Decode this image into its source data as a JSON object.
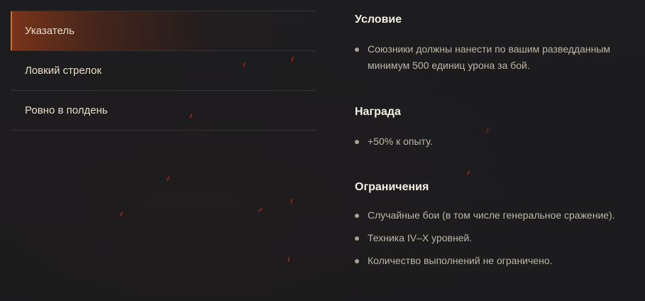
{
  "menu": {
    "items": [
      {
        "label": "Указатель",
        "active": true
      },
      {
        "label": "Ловкий стрелок",
        "active": false
      },
      {
        "label": "Ровно в полдень",
        "active": false
      }
    ]
  },
  "sections": {
    "condition": {
      "title": "Условие",
      "items": [
        "Союзники должны нанести по вашим разведданным минимум 500 единиц урона за бой."
      ]
    },
    "reward": {
      "title": "Награда",
      "items": [
        "+50% к опыту."
      ]
    },
    "restrictions": {
      "title": "Ограничения",
      "items": [
        "Случайные бои (в том числе генеральное сражение).",
        "Техника IV–X уровней.",
        "Количество выполнений не ограничено."
      ]
    }
  },
  "colors": {
    "accent": "#e06a2a",
    "title_text": "#f4efe4",
    "body_text": "#bdb6a8",
    "background": "#1c1c1e"
  }
}
